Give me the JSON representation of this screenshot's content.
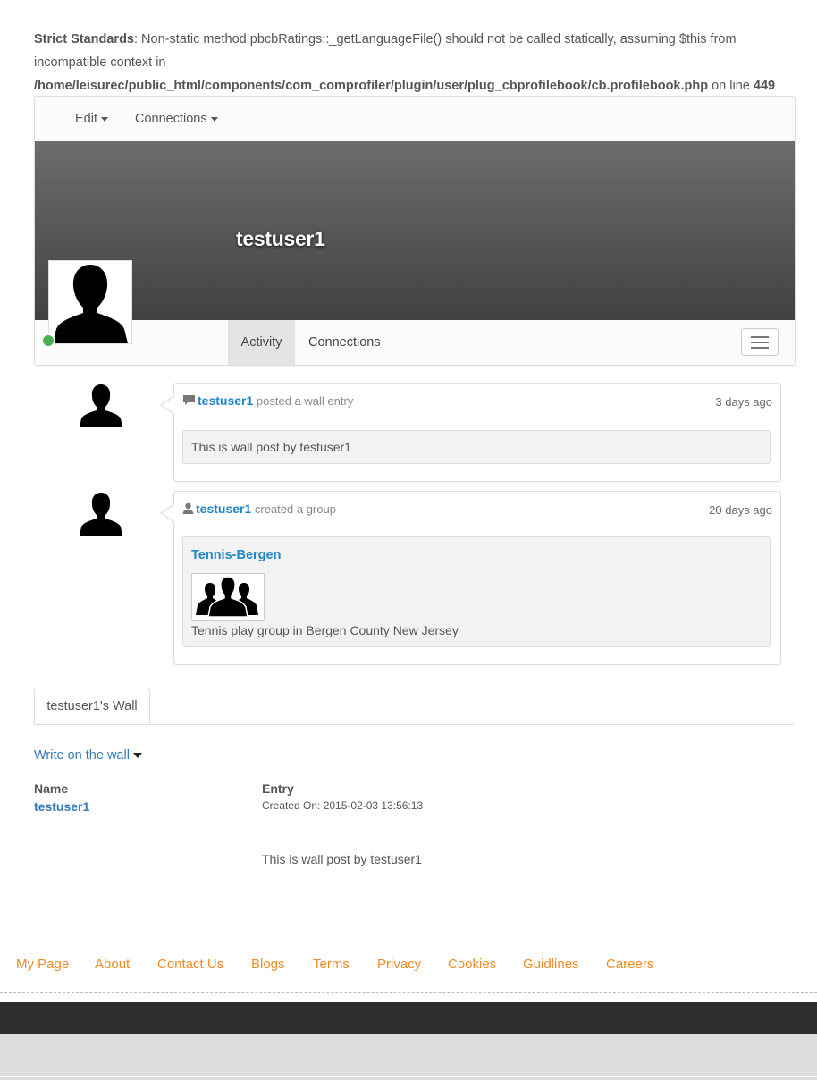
{
  "warning": {
    "label": "Strict Standards",
    "message1": ": Non-static method pbcbRatings::_getLanguageFile() should not be called statically, assuming $this from incompatible context in ",
    "path": "/home/leisurec/public_html/components/com_comprofiler/plugin/user/plug_cbprofilebook/cb.profilebook.php",
    "message2": " on line ",
    "line": "449"
  },
  "topnav": {
    "edit": "Edit",
    "connections": "Connections"
  },
  "profile": {
    "username": "testuser1",
    "online_color": "#4caf50"
  },
  "tabs": {
    "activity": "Activity",
    "connections": "Connections"
  },
  "activity": [
    {
      "user": "testuser1",
      "action": "posted a wall entry",
      "icon": "comment-icon",
      "time": "3 days ago",
      "body": "This is wall post by testuser1"
    },
    {
      "user": "testuser1",
      "action": "created a group",
      "icon": "user-icon",
      "time": "20 days ago",
      "group_name": "Tennis-Bergen",
      "group_desc": "Tennis play group in Bergen County New Jersey"
    }
  ],
  "wall": {
    "tab": "testuser1's Wall",
    "write": "Write on the wall",
    "col_name": "Name",
    "col_entry": "Entry",
    "name": "testuser1",
    "created": "Created On: 2015-02-03 13:56:13",
    "text": "This is wall post by testuser1"
  },
  "footer": {
    "links": [
      "My Page",
      "About",
      "Contact Us",
      "Blogs",
      "Terms",
      "Privacy",
      "Cookies",
      "Guidlines",
      "Careers"
    ],
    "link_color": "#f08a24"
  },
  "colors": {
    "accent": "#1e87c8",
    "link": "#337ab7"
  }
}
